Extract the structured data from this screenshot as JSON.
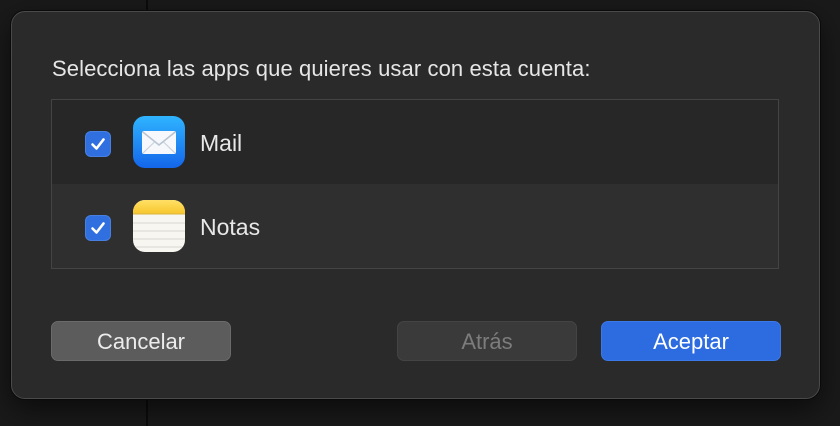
{
  "dialog": {
    "prompt": "Selecciona las apps que quieres usar con esta cuenta:"
  },
  "apps": [
    {
      "name": "Mail",
      "checked": true,
      "icon": "mail-app-icon"
    },
    {
      "name": "Notas",
      "checked": true,
      "icon": "notes-app-icon"
    }
  ],
  "buttons": {
    "cancel_label": "Cancelar",
    "back_label": "Atrás",
    "accept_label": "Aceptar"
  },
  "colors": {
    "accent": "#2d6ce0",
    "checkbox": "#2f6fdf"
  }
}
